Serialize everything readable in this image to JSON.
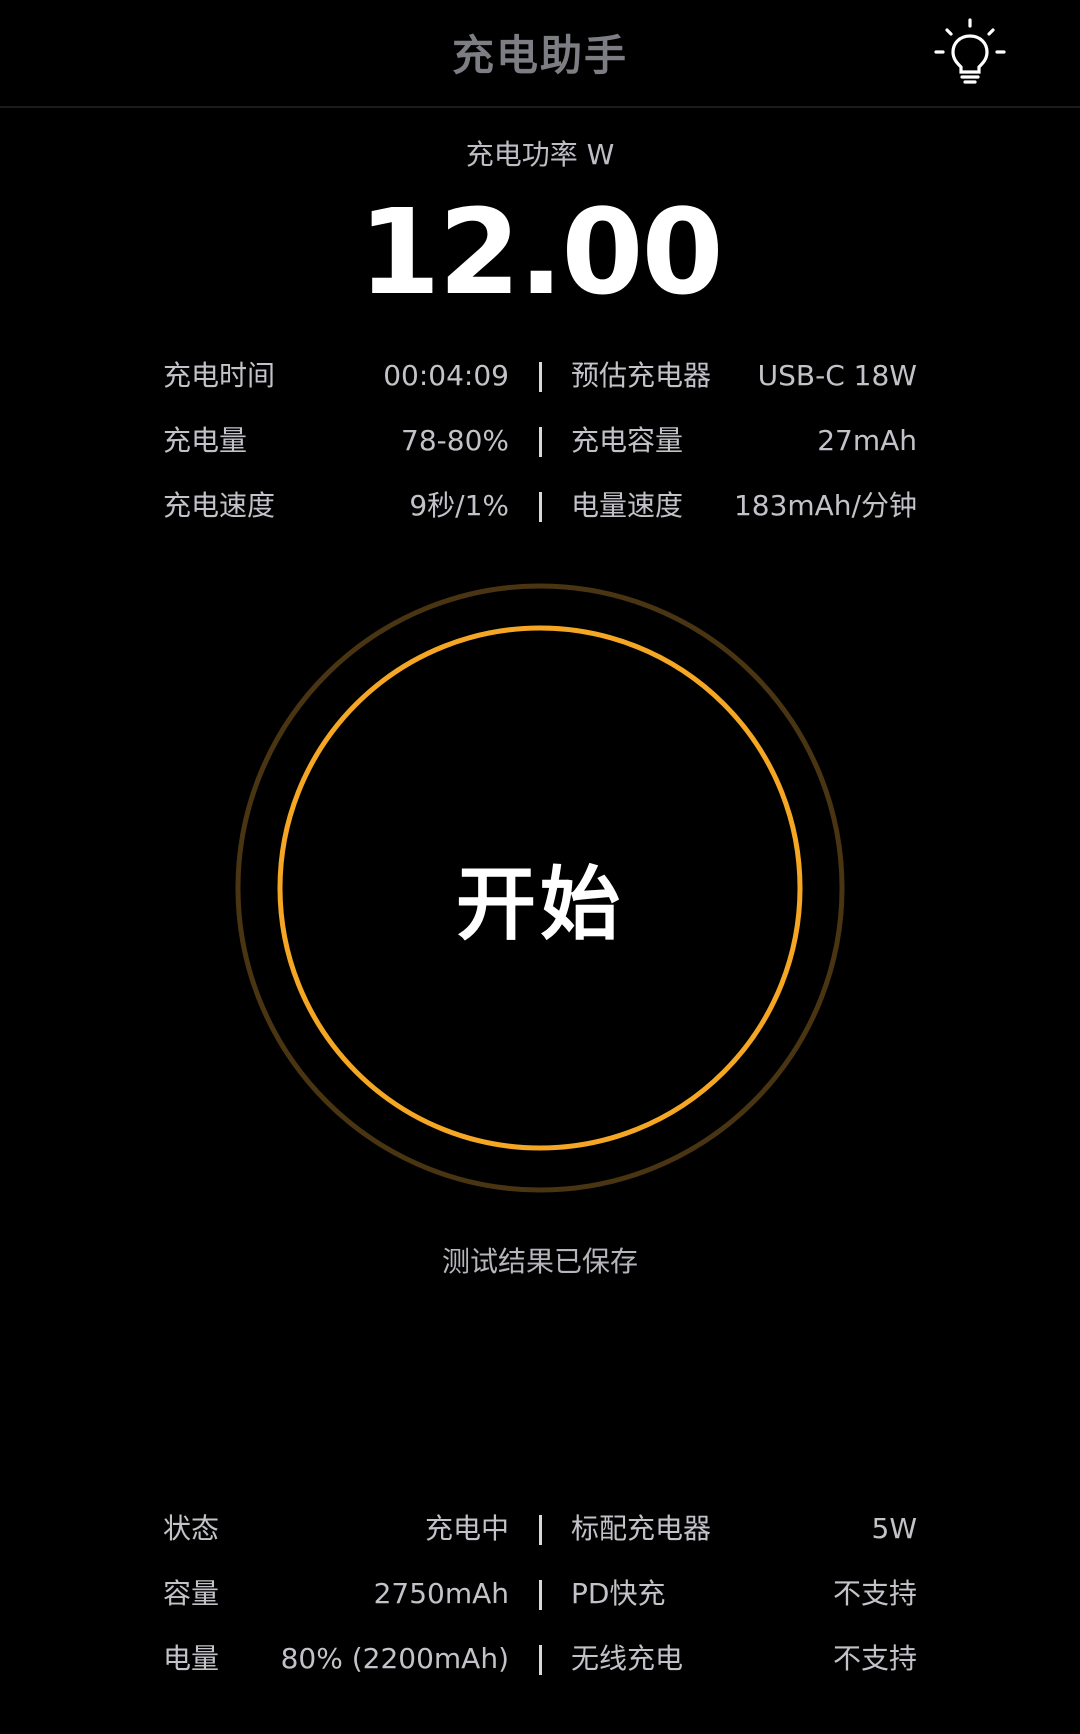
{
  "header": {
    "title": "充电助手",
    "icon": "lightbulb-icon"
  },
  "power": {
    "label": "充电功率 W",
    "value": "12.00"
  },
  "test_stats": [
    {
      "left_label": "充电时间",
      "left_value": "00:04:09",
      "right_label": "预估充电器",
      "right_value": "USB-C 18W"
    },
    {
      "left_label": "充电量",
      "left_value": "78-80%",
      "right_label": "充电容量",
      "right_value": "27mAh"
    },
    {
      "left_label": "充电速度",
      "left_value": "9秒/1%",
      "right_label": "电量速度",
      "right_value": "183mAh/分钟"
    }
  ],
  "start_button": {
    "label": "开始",
    "ring_color": "#f5a623",
    "outer_ring_color": "#4a3512"
  },
  "status_message": "测试结果已保存",
  "device_info": [
    {
      "left_label": "状态",
      "left_value": "充电中",
      "right_label": "标配充电器",
      "right_value": "5W"
    },
    {
      "left_label": "容量",
      "left_value": "2750mAh",
      "right_label": "PD快充",
      "right_value": "不支持"
    },
    {
      "left_label": "电量",
      "left_value": "80% (2200mAh)",
      "right_label": "无线充电",
      "right_value": "不支持"
    }
  ],
  "colors": {
    "background": "#000000",
    "accent": "#f5a623"
  }
}
